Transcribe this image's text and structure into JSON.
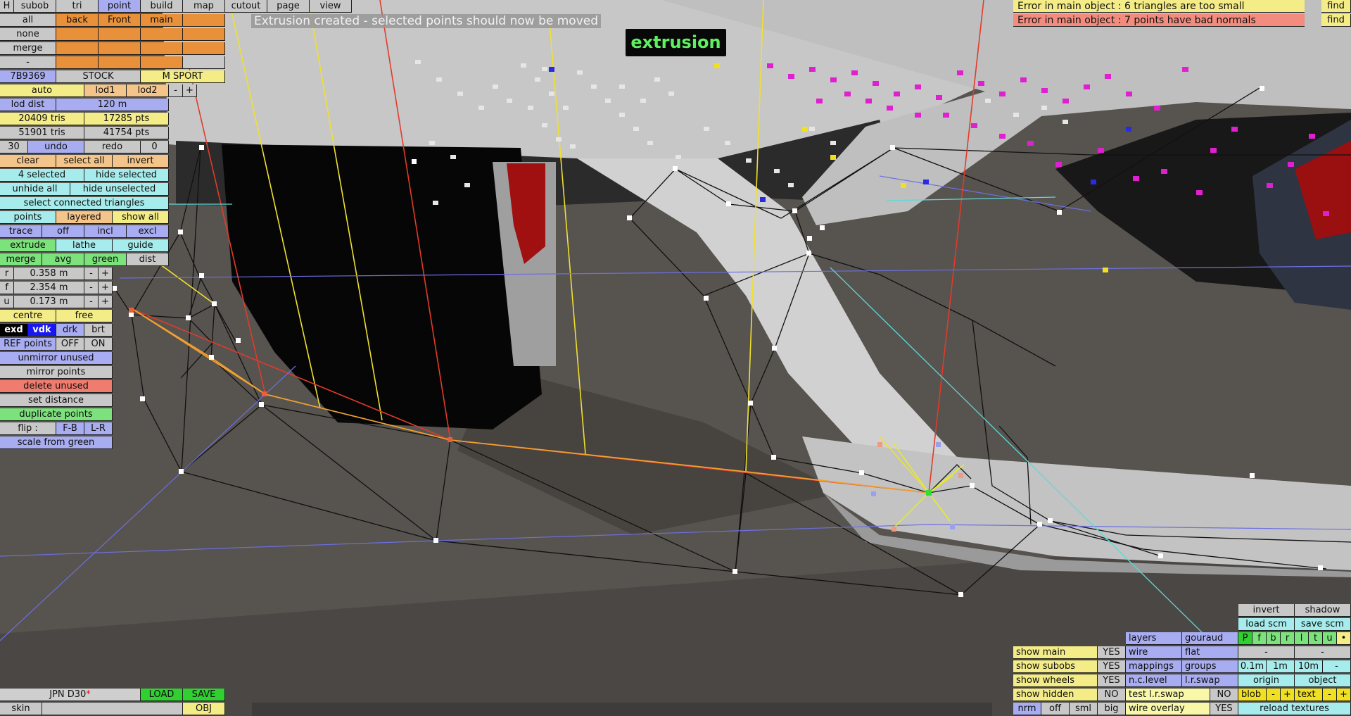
{
  "status_message": "Extrusion created - selected points should now be moved",
  "mode_label": "extrusion",
  "errors": [
    {
      "text": "Error in main object : 6 triangles are too small",
      "action": "find"
    },
    {
      "text": "Error in main object : 7 points have bad normals",
      "action": "find"
    }
  ],
  "menu": {
    "h": "H",
    "tabs": [
      "subob",
      "tri",
      "point",
      "build",
      "map",
      "cutout",
      "page",
      "view"
    ],
    "active": "point"
  },
  "select": {
    "all": "all",
    "none": "none",
    "merge": "merge",
    "dash": "-",
    "back": "back",
    "front": "Front",
    "main": "main"
  },
  "car": {
    "code": "7B9369",
    "stock": "STOCK",
    "variant": "M SPORT"
  },
  "lod": {
    "auto": "auto",
    "lod1": "lod1",
    "lod2": "lod2",
    "minus": "-",
    "plus": "+",
    "dist_label": "lod dist",
    "dist_value": "120 m"
  },
  "stats": {
    "tris1": "20409 tris",
    "pts1": "17285 pts",
    "tris2": "51901 tris",
    "pts2": "41754 pts"
  },
  "history": {
    "count": "30",
    "undo": "undo",
    "redo": "redo",
    "redo_count": "0"
  },
  "selection": {
    "clear": "clear",
    "select_all": "select all",
    "invert": "invert",
    "selected": "4 selected",
    "hide_selected": "hide selected",
    "unhide_all": "unhide all",
    "hide_unselected": "hide unselected",
    "connected": "select connected triangles"
  },
  "display": {
    "points": "points",
    "layered": "layered",
    "show_all": "show all"
  },
  "trace": {
    "trace": "trace",
    "off": "off",
    "incl": "incl",
    "excl": "excl"
  },
  "tools": {
    "extrude": "extrude",
    "lathe": "lathe",
    "guide": "guide",
    "merge": "merge",
    "avg": "avg",
    "green": "green",
    "dist": "dist"
  },
  "coords": {
    "r": "r",
    "r_val": "0.358 m",
    "f": "f",
    "f_val": "2.354 m",
    "u": "u",
    "u_val": "0.173 m",
    "minus": "-",
    "plus": "+"
  },
  "pivot": {
    "centre": "centre",
    "free": "free"
  },
  "shade": {
    "exd": "exd",
    "vdk": "vdk",
    "drk": "drk",
    "brt": "brt"
  },
  "ref": {
    "label": "REF points",
    "off": "OFF",
    "on": "ON"
  },
  "ops": {
    "unmirror": "unmirror unused",
    "mirror": "mirror points",
    "delete": "delete unused",
    "set_distance": "set distance",
    "duplicate": "duplicate points",
    "flip": "flip :",
    "fb": "F-B",
    "lr": "L-R",
    "scale": "scale from green"
  },
  "file": {
    "name": "JPN D30",
    "asterisk": "*",
    "load": "LOAD",
    "save": "SAVE",
    "skin": "skin",
    "obj": "OBJ"
  },
  "rp": {
    "invert": "invert",
    "shadow": "shadow",
    "load_scm": "load scm",
    "save_scm": "save scm",
    "layers": "layers",
    "gouraud": "gouraud",
    "letters": [
      "P",
      "f",
      "b",
      "r",
      "l",
      "t",
      "u",
      "•"
    ],
    "show_main": "show main",
    "yes1": "YES",
    "wire": "wire",
    "flat": "flat",
    "dash": "-",
    "show_subobs": "show subobs",
    "yes2": "YES",
    "mappings": "mappings",
    "groups": "groups",
    "g01": "0.1m",
    "g1": "1m",
    "g10": "10m",
    "gminus": "-",
    "show_wheels": "show wheels",
    "yes3": "YES",
    "nclevel": "n.c.level",
    "lrswap": "l.r.swap",
    "origin": "origin",
    "object": "object",
    "show_hidden": "show hidden",
    "no1": "NO",
    "test_lrswap": "test l.r.swap",
    "no2": "NO",
    "blob": "blob",
    "text": "text",
    "minus": "-",
    "plus": "+",
    "nrm": "nrm",
    "off": "off",
    "sml": "sml",
    "big": "big",
    "wire_overlay": "wire overlay",
    "yes4": "YES",
    "reload": "reload textures"
  },
  "colors": {
    "orange": "#e8903a",
    "blue": "#a8acf0",
    "cyan": "#a6ecec",
    "green": "#7ce27c",
    "yellow": "#f4ec86",
    "red": "#f07c70",
    "magenta": "#e020d0"
  }
}
